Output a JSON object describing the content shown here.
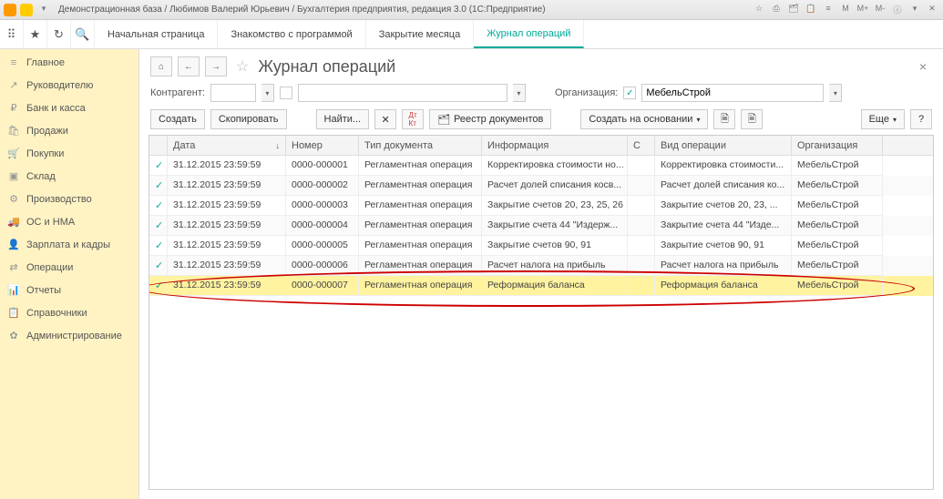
{
  "titlebar": {
    "text": "Демонстрационная база / Любимов Валерий Юрьевич / Бухгалтерия предприятия, редакция 3.0  (1С:Предприятие)",
    "right_labels": [
      "M",
      "M+",
      "M-"
    ]
  },
  "tabs": [
    {
      "label": "Начальная страница"
    },
    {
      "label": "Знакомство с программой"
    },
    {
      "label": "Закрытие месяца"
    },
    {
      "label": "Журнал операций",
      "active": true
    }
  ],
  "sidebar": {
    "items": [
      {
        "icon": "≡",
        "label": "Главное"
      },
      {
        "icon": "↗",
        "label": "Руководителю"
      },
      {
        "icon": "₽",
        "label": "Банк и касса"
      },
      {
        "icon": "🛍",
        "label": "Продажи"
      },
      {
        "icon": "🛒",
        "label": "Покупки"
      },
      {
        "icon": "▣",
        "label": "Склад"
      },
      {
        "icon": "⚙",
        "label": "Производство"
      },
      {
        "icon": "🚚",
        "label": "ОС и НМА"
      },
      {
        "icon": "👤",
        "label": "Зарплата и кадры"
      },
      {
        "icon": "⇄",
        "label": "Операции"
      },
      {
        "icon": "📊",
        "label": "Отчеты"
      },
      {
        "icon": "📋",
        "label": "Справочники"
      },
      {
        "icon": "✿",
        "label": "Администрирование"
      }
    ]
  },
  "page": {
    "title": "Журнал операций",
    "filter": {
      "kontragent_label": "Контрагент:",
      "org_label": "Организация:",
      "org_value": "МебельСтрой"
    },
    "toolbar": {
      "create": "Создать",
      "copy": "Скопировать",
      "find": "Найти...",
      "registry": "Реестр документов",
      "basis": "Создать на основании",
      "more": "Еще"
    },
    "columns": {
      "date": "Дата",
      "number": "Номер",
      "doctype": "Тип документа",
      "info": "Информация",
      "c": "С",
      "optype": "Вид операции",
      "org": "Организация"
    },
    "rows": [
      {
        "date": "31.12.2015 23:59:59",
        "num": "0000-000001",
        "type": "Регламентная операция",
        "info": "Корректировка стоимости но...",
        "op": "Корректировка стоимости...",
        "org": "МебельСтрой"
      },
      {
        "date": "31.12.2015 23:59:59",
        "num": "0000-000002",
        "type": "Регламентная операция",
        "info": "Расчет долей списания косв...",
        "op": "Расчет долей списания ко...",
        "org": "МебельСтрой"
      },
      {
        "date": "31.12.2015 23:59:59",
        "num": "0000-000003",
        "type": "Регламентная операция",
        "info": "Закрытие счетов 20, 23, 25, 26",
        "op": "Закрытие счетов 20, 23, ...",
        "org": "МебельСтрой"
      },
      {
        "date": "31.12.2015 23:59:59",
        "num": "0000-000004",
        "type": "Регламентная операция",
        "info": "Закрытие счета 44 \"Издерж...",
        "op": "Закрытие счета 44 \"Изде...",
        "org": "МебельСтрой"
      },
      {
        "date": "31.12.2015 23:59:59",
        "num": "0000-000005",
        "type": "Регламентная операция",
        "info": "Закрытие счетов 90, 91",
        "op": "Закрытие счетов 90, 91",
        "org": "МебельСтрой"
      },
      {
        "date": "31.12.2015 23:59:59",
        "num": "0000-000006",
        "type": "Регламентная операция",
        "info": "Расчет налога на прибыль",
        "op": "Расчет налога на прибыль",
        "org": "МебельСтрой"
      },
      {
        "date": "31.12.2015 23:59:59",
        "num": "0000-000007",
        "type": "Регламентная операция",
        "info": "Реформация баланса",
        "op": "Реформация баланса",
        "org": "МебельСтрой",
        "selected": true
      }
    ]
  }
}
